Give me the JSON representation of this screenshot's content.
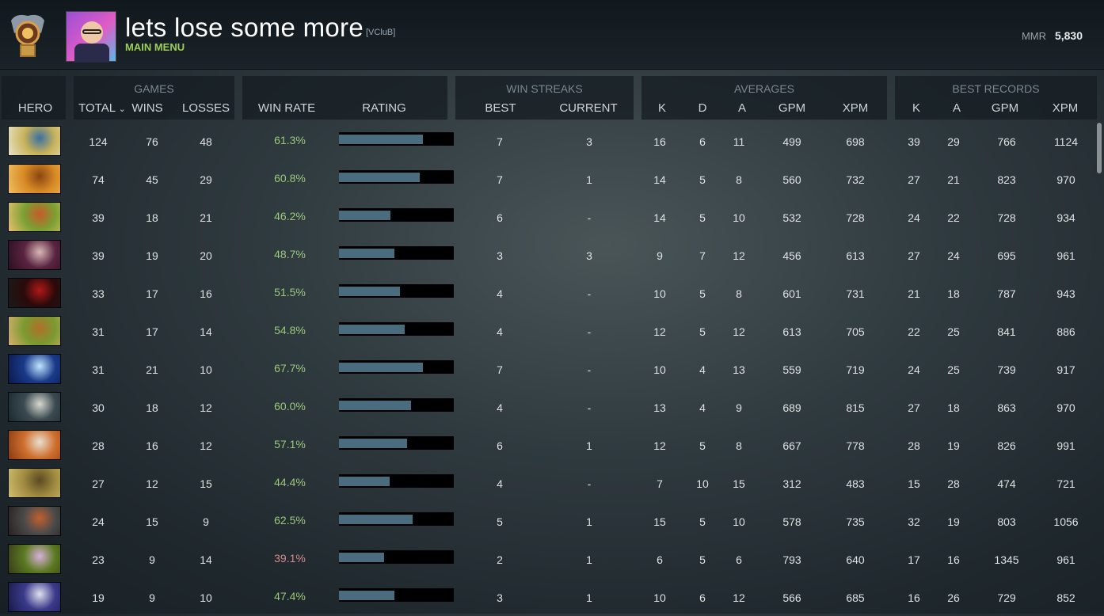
{
  "player": {
    "name": "lets lose some more",
    "clan_tag": "[VCluB]",
    "menu_label": "MAIN MENU",
    "mmr_label": "MMR",
    "mmr_value": "5,830"
  },
  "groups": {
    "games": "GAMES",
    "win_streaks": "WIN STREAKS",
    "averages": "AVERAGES",
    "best_records": "BEST RECORDS"
  },
  "columns": {
    "hero": "HERO",
    "total": "TOTAL",
    "wins": "WINS",
    "losses": "LOSSES",
    "win_rate": "WIN RATE",
    "rating": "RATING",
    "best": "BEST",
    "current": "CURRENT",
    "avg_k": "K",
    "avg_d": "D",
    "avg_a": "A",
    "avg_gpm": "GPM",
    "avg_xpm": "XPM",
    "best_k": "K",
    "best_a": "A",
    "best_gpm": "GPM",
    "best_xpm": "XPM"
  },
  "sort_icon": "chevron-down-icon",
  "accent_colors": {
    "menu": "#9bcf58",
    "winrate": "#9bc77b",
    "winrate_low": "#d58a8a",
    "rating_fill": "#4b6b7e"
  },
  "rows": [
    {
      "total": "124",
      "wins": "76",
      "losses": "48",
      "win_rate": "61.3%",
      "rating": 0.73,
      "best": "7",
      "current": "3",
      "k": "16",
      "d": "6",
      "a": "11",
      "gpm": "499",
      "xpm": "698",
      "bk": "39",
      "ba": "29",
      "bgpm": "766",
      "bxpm": "1124",
      "icon_colors": [
        "#c9b35a",
        "#3b6fa0",
        "#e8e3c8"
      ]
    },
    {
      "total": "74",
      "wins": "45",
      "losses": "29",
      "win_rate": "60.8%",
      "rating": 0.7,
      "best": "7",
      "current": "1",
      "k": "14",
      "d": "5",
      "a": "8",
      "gpm": "560",
      "xpm": "732",
      "bk": "27",
      "ba": "21",
      "bgpm": "823",
      "bxpm": "970",
      "icon_colors": [
        "#d88a25",
        "#8a4512",
        "#f0c060"
      ]
    },
    {
      "total": "39",
      "wins": "18",
      "losses": "21",
      "win_rate": "46.2%",
      "rating": 0.45,
      "best": "6",
      "current": "-",
      "k": "14",
      "d": "5",
      "a": "10",
      "gpm": "532",
      "xpm": "728",
      "bk": "24",
      "ba": "22",
      "bgpm": "728",
      "bxpm": "934",
      "icon_colors": [
        "#7aa033",
        "#c75a2a",
        "#e9c070"
      ]
    },
    {
      "total": "39",
      "wins": "19",
      "losses": "20",
      "win_rate": "48.7%",
      "rating": 0.48,
      "best": "3",
      "current": "3",
      "k": "9",
      "d": "7",
      "a": "12",
      "gpm": "456",
      "xpm": "613",
      "bk": "27",
      "ba": "24",
      "bgpm": "695",
      "bxpm": "961",
      "icon_colors": [
        "#5a2440",
        "#d9b8b8",
        "#2a0f1f"
      ]
    },
    {
      "total": "33",
      "wins": "17",
      "losses": "16",
      "win_rate": "51.5%",
      "rating": 0.53,
      "best": "4",
      "current": "-",
      "k": "10",
      "d": "5",
      "a": "8",
      "gpm": "601",
      "xpm": "731",
      "bk": "21",
      "ba": "18",
      "bgpm": "787",
      "bxpm": "943",
      "icon_colors": [
        "#2a0a0a",
        "#b01818",
        "#1a1a1a"
      ]
    },
    {
      "total": "31",
      "wins": "17",
      "losses": "14",
      "win_rate": "54.8%",
      "rating": 0.57,
      "best": "4",
      "current": "-",
      "k": "12",
      "d": "5",
      "a": "12",
      "gpm": "613",
      "xpm": "705",
      "bk": "22",
      "ba": "25",
      "bgpm": "841",
      "bxpm": "886",
      "icon_colors": [
        "#7a9a30",
        "#b0702a",
        "#d8b070"
      ]
    },
    {
      "total": "31",
      "wins": "21",
      "losses": "10",
      "win_rate": "67.7%",
      "rating": 0.73,
      "best": "7",
      "current": "-",
      "k": "10",
      "d": "4",
      "a": "13",
      "gpm": "559",
      "xpm": "719",
      "bk": "24",
      "ba": "25",
      "bgpm": "739",
      "bxpm": "917",
      "icon_colors": [
        "#1a3a8a",
        "#bfe6ff",
        "#0a1a4a"
      ]
    },
    {
      "total": "30",
      "wins": "18",
      "losses": "12",
      "win_rate": "60.0%",
      "rating": 0.63,
      "best": "4",
      "current": "-",
      "k": "13",
      "d": "4",
      "a": "9",
      "gpm": "689",
      "xpm": "815",
      "bk": "27",
      "ba": "18",
      "bgpm": "863",
      "bxpm": "970",
      "icon_colors": [
        "#3a4a50",
        "#d8d8d0",
        "#1a2a30"
      ]
    },
    {
      "total": "28",
      "wins": "16",
      "losses": "12",
      "win_rate": "57.1%",
      "rating": 0.59,
      "best": "6",
      "current": "1",
      "k": "12",
      "d": "5",
      "a": "8",
      "gpm": "667",
      "xpm": "778",
      "bk": "28",
      "ba": "19",
      "bgpm": "826",
      "bxpm": "991",
      "icon_colors": [
        "#d07030",
        "#e8e0d0",
        "#8a3a10"
      ]
    },
    {
      "total": "27",
      "wins": "12",
      "losses": "15",
      "win_rate": "44.4%",
      "rating": 0.44,
      "best": "4",
      "current": "-",
      "k": "7",
      "d": "10",
      "a": "15",
      "gpm": "312",
      "xpm": "483",
      "bk": "15",
      "ba": "28",
      "bgpm": "474",
      "bxpm": "721",
      "icon_colors": [
        "#a08a40",
        "#5a4a20",
        "#d0c070"
      ]
    },
    {
      "total": "24",
      "wins": "15",
      "losses": "9",
      "win_rate": "62.5%",
      "rating": 0.64,
      "best": "5",
      "current": "1",
      "k": "15",
      "d": "5",
      "a": "10",
      "gpm": "578",
      "xpm": "735",
      "bk": "32",
      "ba": "19",
      "bgpm": "803",
      "bxpm": "1056",
      "icon_colors": [
        "#4a4a4a",
        "#c06030",
        "#2a2020"
      ]
    },
    {
      "total": "23",
      "wins": "9",
      "losses": "14",
      "win_rate": "39.1%",
      "rating": 0.39,
      "best": "2",
      "current": "1",
      "k": "6",
      "d": "5",
      "a": "6",
      "gpm": "793",
      "xpm": "640",
      "bk": "17",
      "ba": "16",
      "bgpm": "1345",
      "bxpm": "961",
      "icon_colors": [
        "#5a7a20",
        "#d8b0d8",
        "#3a3a1a"
      ]
    },
    {
      "total": "19",
      "wins": "9",
      "losses": "10",
      "win_rate": "47.4%",
      "rating": 0.48,
      "best": "3",
      "current": "1",
      "k": "10",
      "d": "6",
      "a": "12",
      "gpm": "566",
      "xpm": "685",
      "bk": "16",
      "ba": "26",
      "bgpm": "729",
      "bxpm": "852",
      "icon_colors": [
        "#3a3a8a",
        "#e0e0f0",
        "#1a1a4a"
      ]
    }
  ]
}
